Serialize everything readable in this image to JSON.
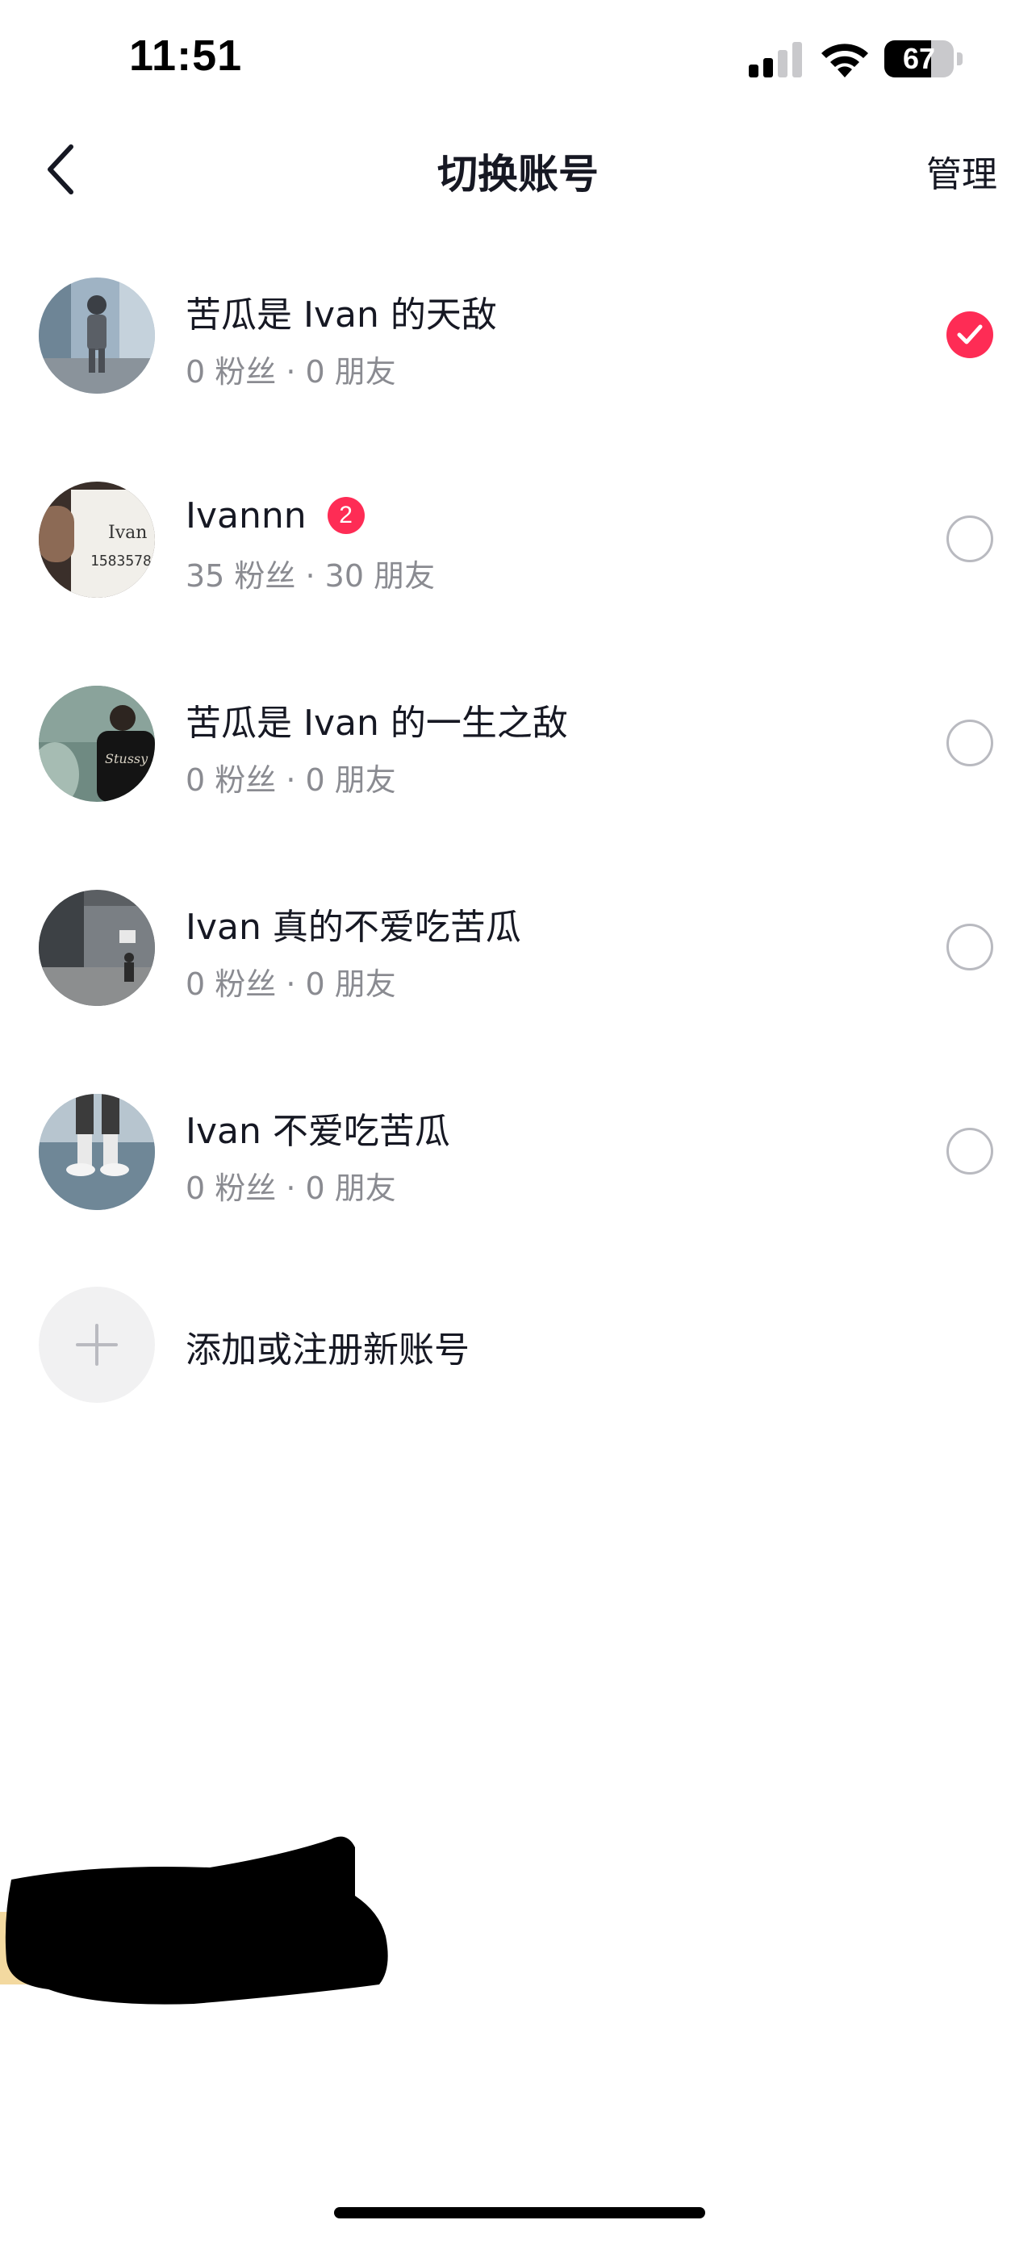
{
  "status_bar": {
    "time": "11:51",
    "battery_level": "67",
    "battery_fraction": 0.67
  },
  "nav": {
    "back_icon": "chevron-left-icon",
    "title": "切换账号",
    "manage_label": "管理"
  },
  "accounts": [
    {
      "name": "苦瓜是 Ivan 的天敌",
      "stats": "0 粉丝 · 0 朋友",
      "selected": true,
      "badge": ""
    },
    {
      "name": "Ivannn",
      "stats": "35 粉丝 · 30 朋友",
      "selected": false,
      "badge": "2"
    },
    {
      "name": "苦瓜是 Ivan 的一生之敌",
      "stats": "0 粉丝 · 0 朋友",
      "selected": false,
      "badge": ""
    },
    {
      "name": "Ivan 真的不爱吃苦瓜",
      "stats": "0 粉丝 · 0 朋友",
      "selected": false,
      "badge": ""
    },
    {
      "name": "Ivan 不爱吃苦瓜",
      "stats": "0 粉丝 · 0 朋友",
      "selected": false,
      "badge": ""
    }
  ],
  "add_account": {
    "icon": "plus-icon",
    "label": "添加或注册新账号"
  },
  "colors": {
    "accent": "#fe2c55",
    "text_primary": "#161823",
    "text_secondary": "#8a8b91",
    "radio_border": "#b9bac0"
  }
}
